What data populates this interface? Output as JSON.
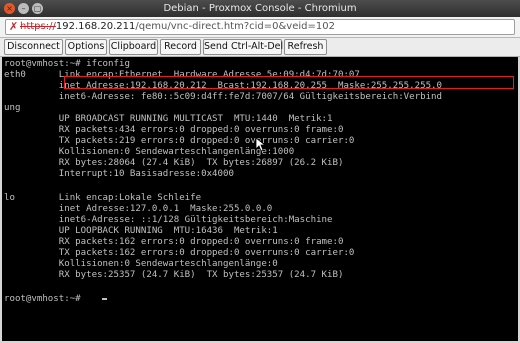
{
  "window": {
    "title": "Debian - Proxmox Console - Chromium",
    "buttons": [
      "×",
      "–",
      "▢"
    ]
  },
  "address_bar": {
    "scheme": "https://",
    "host": "192.168.20.211",
    "path": "/qemu/vnc-direct.htm?cid=0&veid=102"
  },
  "toolbar": {
    "buttons": [
      "Disconnect",
      "Options",
      "Clipboard",
      "Record",
      "Send Ctrl-Alt-Del",
      "Refresh"
    ]
  },
  "console": {
    "lines": [
      "root@vmhost:~# ifconfig",
      "eth0      Link encap:Ethernet  Hardware Adresse 5e:09:d4:7d:70:07",
      "          inet Adresse:192.168.20.212  Bcast:192.168.20.255  Maske:255.255.255.0",
      "          inet6-Adresse: fe80::5c09:d4ff:fe7d:7007/64 Gültigkeitsbereich:Verbind",
      "ung",
      "          UP BROADCAST RUNNING MULTICAST  MTU:1440  Metrik:1",
      "          RX packets:434 errors:0 dropped:0 overruns:0 frame:0",
      "          TX packets:219 errors:0 dropped:0 overruns:0 carrier:0",
      "          Kollisionen:0 Sendewarteschlangenlänge:1000",
      "          RX bytes:28064 (27.4 KiB)  TX bytes:26897 (26.2 KiB)",
      "          Interrupt:10 Basisadresse:0x4000",
      "",
      "lo        Link encap:Lokale Schleife",
      "          inet Adresse:127.0.0.1  Maske:255.0.0.0",
      "          inet6-Adresse: ::1/128 Gültigkeitsbereich:Maschine",
      "          UP LOOPBACK RUNNING  MTU:16436  Metrik:1",
      "          RX packets:162 errors:0 dropped:0 overruns:0 frame:0",
      "          TX packets:162 errors:0 dropped:0 overruns:0 carrier:0",
      "          Kollisionen:0 Sendewarteschlangenlänge:0",
      "          RX bytes:25357 (24.7 KiB)  TX bytes:25357 (24.7 KiB)",
      "",
      "root@vmhost:~# "
    ]
  },
  "colors": {
    "terminal_bg": "#000000",
    "terminal_fg": "#c0c0c0",
    "highlight": "#e02020",
    "titlebar": "#3c3c3c"
  }
}
